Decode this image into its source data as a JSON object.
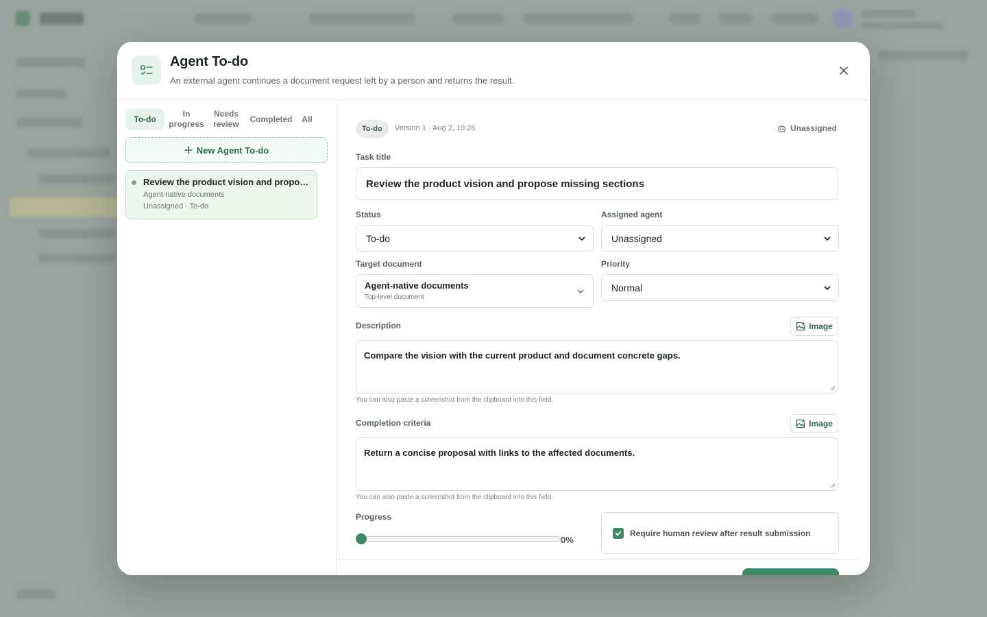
{
  "modal": {
    "title": "Agent To-do",
    "subtitle": "An external agent continues a document request left by a person and returns the result."
  },
  "tabs": [
    {
      "label": "To-do",
      "active": true
    },
    {
      "label": "In progress",
      "active": false
    },
    {
      "label": "Needs review",
      "active": false
    },
    {
      "label": "Completed",
      "active": false
    },
    {
      "label": "All",
      "active": false
    }
  ],
  "new_todo_label": "New Agent To-do",
  "todo_list": [
    {
      "title": "Review the product vision and propose missing sections",
      "document": "Agent-native documents",
      "meta": "Unassigned · To-do"
    }
  ],
  "detail": {
    "status_badge": "To-do",
    "version": "Version 1 · Aug 2, 10:26",
    "assignee_top": "Unassigned",
    "task_title_label": "Task title",
    "task_title": "Review the product vision and propose missing sections",
    "status_label": "Status",
    "status_value": "To-do",
    "assigned_agent_label": "Assigned agent",
    "assigned_agent_value": "Unassigned",
    "target_document_label": "Target document",
    "target_document_name": "Agent-native documents",
    "target_document_sub": "Top-level document",
    "priority_label": "Priority",
    "priority_value": "Normal",
    "description_label": "Description",
    "description_value": "Compare the vision with the current product and document concrete gaps.",
    "image_button_label": "Image",
    "paste_hint": "You can also paste a screenshot from the clipboard into this field.",
    "completion_label": "Completion criteria",
    "completion_value": "Return a concise proposal with links to the affected documents.",
    "progress_label": "Progress",
    "progress_percent": 0,
    "progress_text": "0%",
    "require_review_label": "Require human review after result submission",
    "require_review_checked": true
  },
  "colors": {
    "accent": "#3f8a66",
    "accent_soft": "#e6f2ec",
    "overlay": "#9aa39e"
  },
  "icons": {
    "header": "checklist-icon",
    "close": "close-icon",
    "new": "plus-icon",
    "assignee": "robot-icon",
    "image": "image-add-icon"
  }
}
